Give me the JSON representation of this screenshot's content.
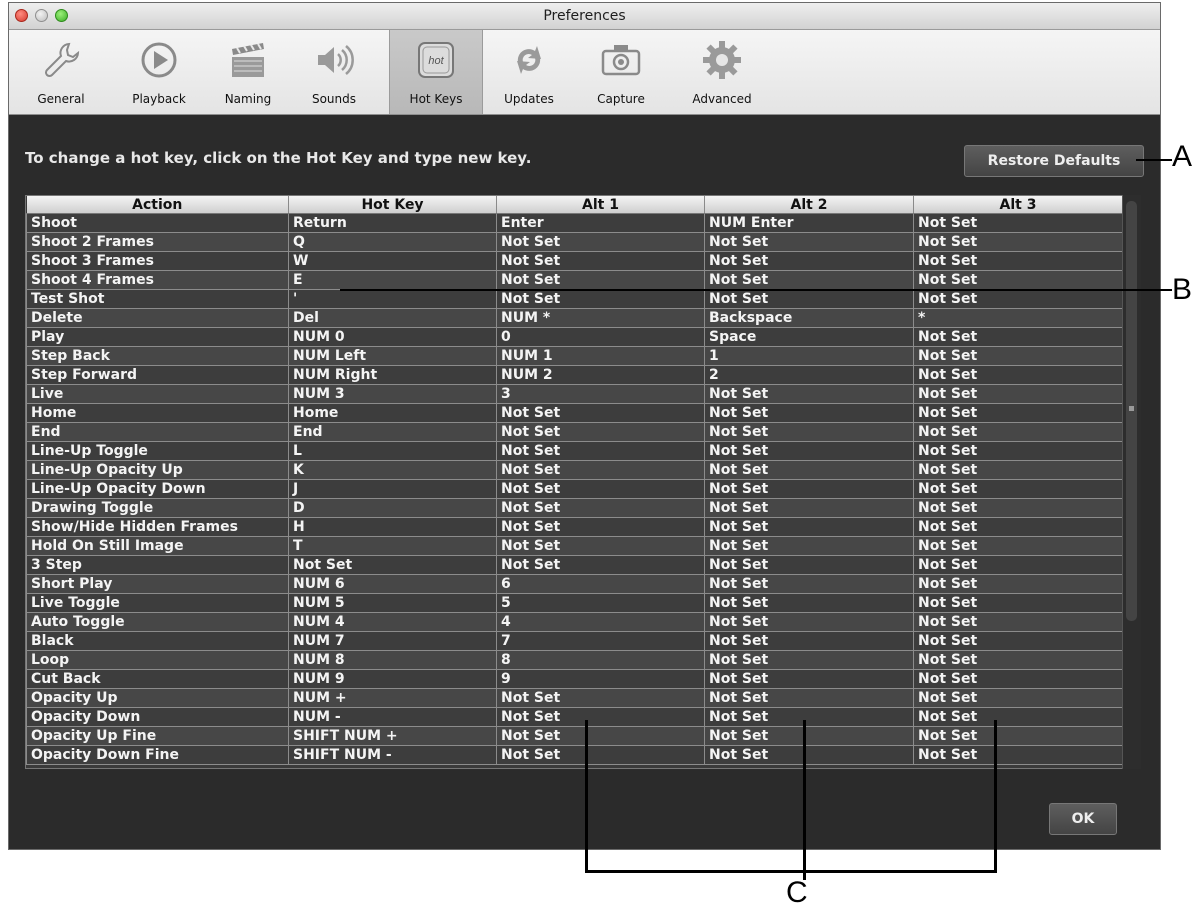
{
  "window": {
    "title": "Preferences"
  },
  "toolbar": {
    "items": [
      {
        "label": "General",
        "icon": "wrench-icon"
      },
      {
        "label": "Playback",
        "icon": "play-icon"
      },
      {
        "label": "Naming",
        "icon": "clapperboard-icon"
      },
      {
        "label": "Sounds",
        "icon": "speaker-icon"
      },
      {
        "label": "Hot Keys",
        "icon": "hotkey-icon",
        "icon_text": "hot",
        "selected": true
      },
      {
        "label": "Updates",
        "icon": "refresh-icon"
      },
      {
        "label": "Capture",
        "icon": "camera-icon"
      },
      {
        "label": "Advanced",
        "icon": "gear-icon"
      }
    ]
  },
  "hint": "To change a hot key, click on the Hot Key and type new key.",
  "buttons": {
    "restore_defaults": "Restore Defaults",
    "ok": "OK"
  },
  "table": {
    "columns": [
      "Action",
      "Hot Key",
      "Alt 1",
      "Alt 2",
      "Alt 3"
    ],
    "rows": [
      [
        "Shoot",
        "Return",
        "Enter",
        "NUM Enter",
        "Not Set"
      ],
      [
        "Shoot 2 Frames",
        "Q",
        "Not Set",
        "Not Set",
        "Not Set"
      ],
      [
        "Shoot 3 Frames",
        "W",
        "Not Set",
        "Not Set",
        "Not Set"
      ],
      [
        "Shoot 4 Frames",
        "E",
        "Not Set",
        "Not Set",
        "Not Set"
      ],
      [
        "Test Shot",
        "'",
        "Not Set",
        "Not Set",
        "Not Set"
      ],
      [
        "Delete",
        "Del",
        "NUM *",
        "Backspace",
        "*"
      ],
      [
        "Play",
        "NUM 0",
        "0",
        "Space",
        "Not Set"
      ],
      [
        "Step Back",
        "NUM Left",
        "NUM 1",
        "1",
        "Not Set"
      ],
      [
        "Step Forward",
        "NUM Right",
        "NUM 2",
        "2",
        "Not Set"
      ],
      [
        "Live",
        "NUM 3",
        "3",
        "Not Set",
        "Not Set"
      ],
      [
        "Home",
        "Home",
        "Not Set",
        "Not Set",
        "Not Set"
      ],
      [
        "End",
        "End",
        "Not Set",
        "Not Set",
        "Not Set"
      ],
      [
        "Line-Up Toggle",
        "L",
        "Not Set",
        "Not Set",
        "Not Set"
      ],
      [
        "Line-Up Opacity Up",
        "K",
        "Not Set",
        "Not Set",
        "Not Set"
      ],
      [
        "Line-Up Opacity Down",
        "J",
        "Not Set",
        "Not Set",
        "Not Set"
      ],
      [
        "Drawing Toggle",
        "D",
        "Not Set",
        "Not Set",
        "Not Set"
      ],
      [
        "Show/Hide Hidden Frames",
        "H",
        "Not Set",
        "Not Set",
        "Not Set"
      ],
      [
        "Hold On Still Image",
        "T",
        "Not Set",
        "Not Set",
        "Not Set"
      ],
      [
        "3 Step",
        "Not Set",
        "Not Set",
        "Not Set",
        "Not Set"
      ],
      [
        "Short Play",
        "NUM 6",
        "6",
        "Not Set",
        "Not Set"
      ],
      [
        "Live Toggle",
        "NUM 5",
        "5",
        "Not Set",
        "Not Set"
      ],
      [
        "Auto Toggle",
        "NUM 4",
        "4",
        "Not Set",
        "Not Set"
      ],
      [
        "Black",
        "NUM 7",
        "7",
        "Not Set",
        "Not Set"
      ],
      [
        "Loop",
        "NUM 8",
        "8",
        "Not Set",
        "Not Set"
      ],
      [
        "Cut Back",
        "NUM 9",
        "9",
        "Not Set",
        "Not Set"
      ],
      [
        "Opacity Up",
        "NUM +",
        "Not Set",
        "Not Set",
        "Not Set"
      ],
      [
        "Opacity Down",
        "NUM -",
        "Not Set",
        "Not Set",
        "Not Set"
      ],
      [
        "Opacity Up Fine",
        "SHIFT NUM +",
        "Not Set",
        "Not Set",
        "Not Set"
      ],
      [
        "Opacity Down Fine",
        "SHIFT NUM -",
        "Not Set",
        "Not Set",
        "Not Set"
      ]
    ]
  },
  "callouts": {
    "a": "A",
    "b": "B",
    "c": "C"
  }
}
